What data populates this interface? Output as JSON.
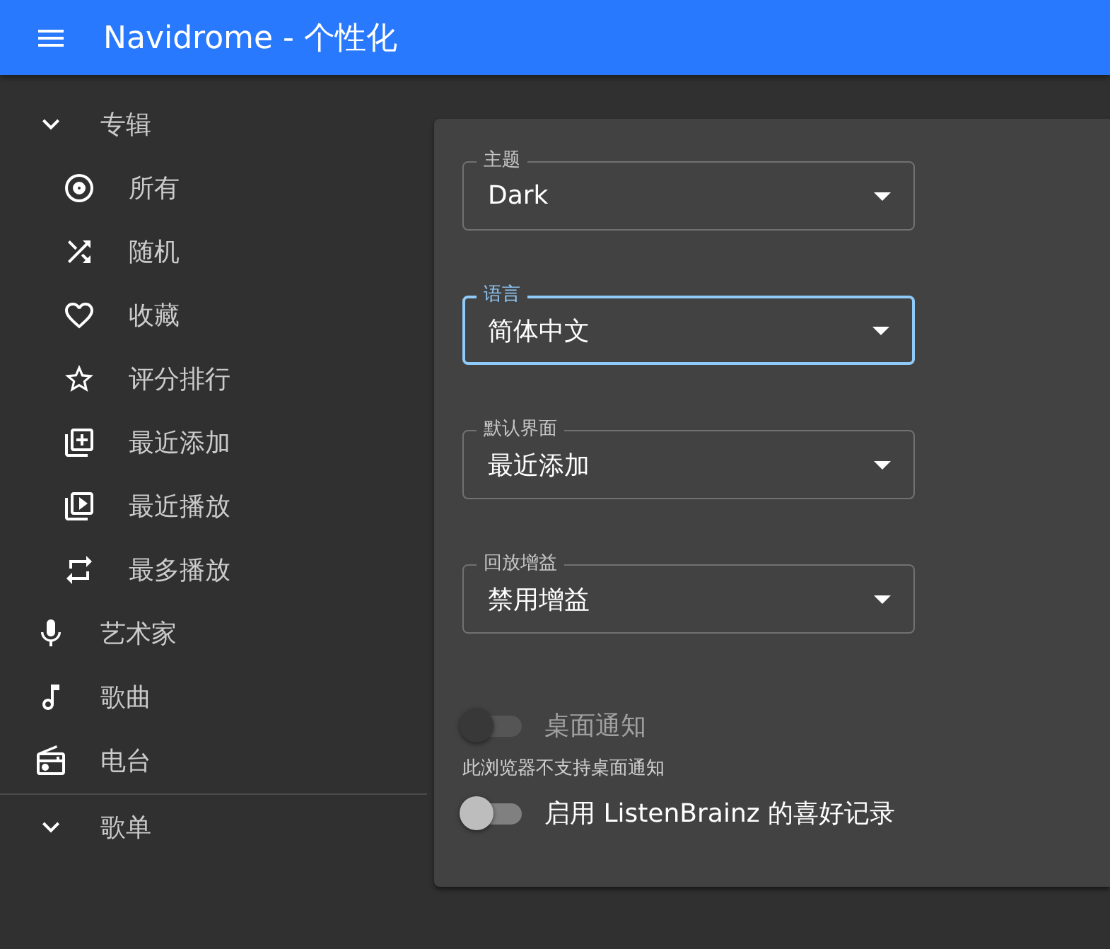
{
  "app_bar": {
    "title": "Navidrome - 个性化"
  },
  "sidebar": {
    "items": [
      {
        "kind": "group",
        "label": "专辑",
        "children": [
          {
            "label": "所有"
          },
          {
            "label": "随机"
          },
          {
            "label": "收藏"
          },
          {
            "label": "评分排行"
          },
          {
            "label": "最近添加"
          },
          {
            "label": "最近播放"
          },
          {
            "label": "最多播放"
          }
        ]
      },
      {
        "kind": "link",
        "label": "艺术家"
      },
      {
        "kind": "link",
        "label": "歌曲"
      },
      {
        "kind": "link",
        "label": "电台"
      },
      {
        "kind": "group",
        "label": "歌单"
      }
    ]
  },
  "settings": {
    "selects": [
      {
        "label": "主题",
        "value": "Dark",
        "focused": false
      },
      {
        "label": "语言",
        "value": "简体中文",
        "focused": true
      },
      {
        "label": "默认界面",
        "value": "最近添加",
        "focused": false
      },
      {
        "label": "回放增益",
        "value": "禁用增益",
        "focused": false
      }
    ],
    "toggles": [
      {
        "label": "桌面通知",
        "checked": false,
        "disabled": true,
        "helper": "此浏览器不支持桌面通知"
      },
      {
        "label": "启用 ListenBrainz 的喜好记录",
        "checked": false,
        "disabled": false
      }
    ]
  }
}
